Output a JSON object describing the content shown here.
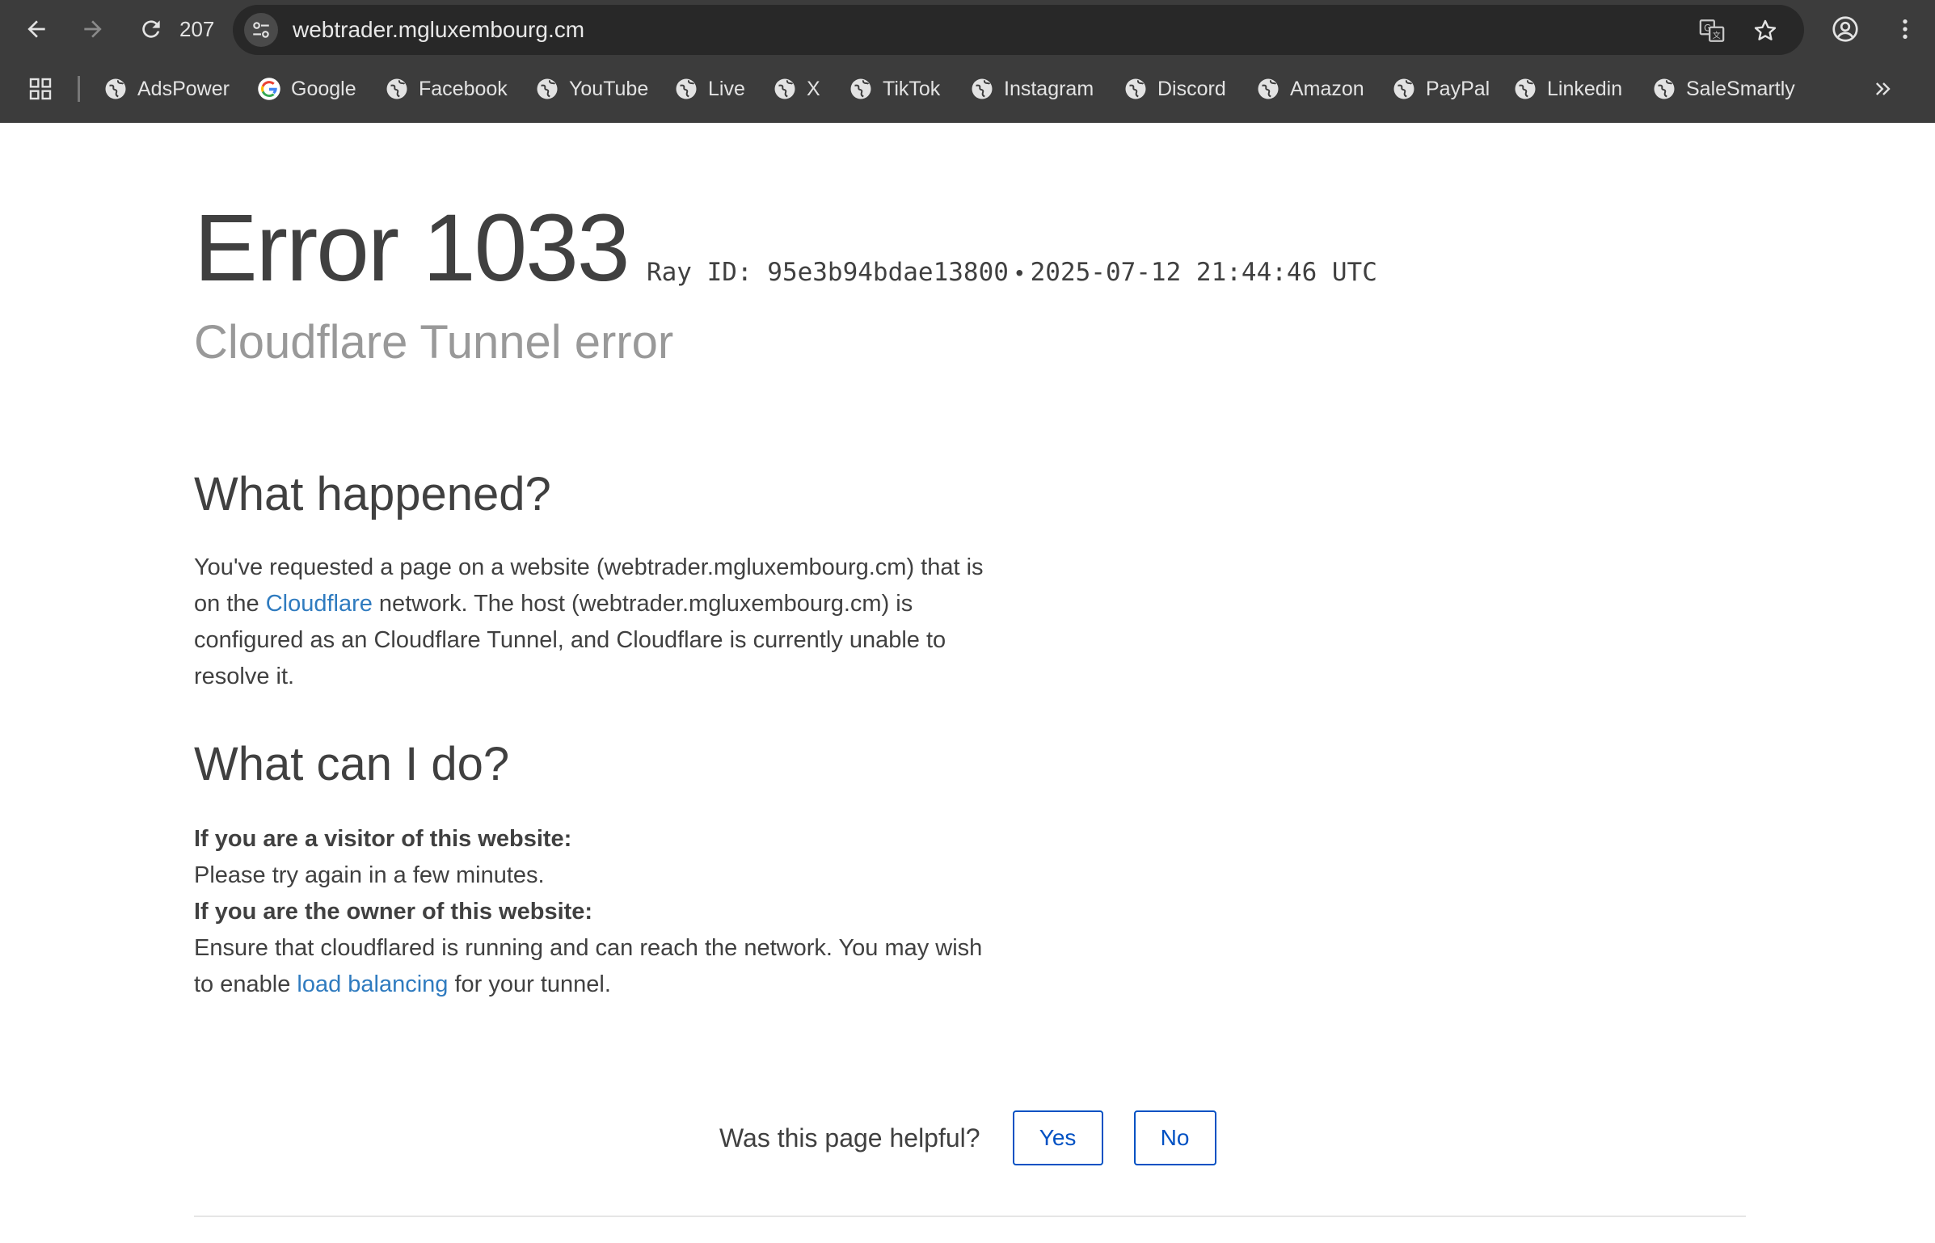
{
  "browser": {
    "tab_count": "207",
    "url": "webtrader.mgluxembourg.cm",
    "bookmarks": [
      {
        "label": "AdsPower",
        "icon": "globe-icon"
      },
      {
        "label": "Google",
        "icon": "google-icon"
      },
      {
        "label": "Facebook",
        "icon": "globe-icon"
      },
      {
        "label": "YouTube",
        "icon": "globe-icon"
      },
      {
        "label": "Live",
        "icon": "globe-icon"
      },
      {
        "label": "X",
        "icon": "globe-icon"
      },
      {
        "label": "TikTok",
        "icon": "globe-icon"
      },
      {
        "label": "Instagram",
        "icon": "globe-icon"
      },
      {
        "label": "Discord",
        "icon": "globe-icon"
      },
      {
        "label": "Amazon",
        "icon": "globe-icon"
      },
      {
        "label": "PayPal",
        "icon": "globe-icon"
      },
      {
        "label": "Linkedin",
        "icon": "globe-icon"
      },
      {
        "label": "SaleSmartly",
        "icon": "globe-icon"
      }
    ]
  },
  "error": {
    "title": "Error 1033",
    "ray_id": "Ray ID: 95e3b94bdae13800",
    "dot": "•",
    "timestamp": "2025-07-12 21:44:46 UTC",
    "subtitle": "Cloudflare Tunnel error"
  },
  "what_happened": {
    "heading": "What happened?",
    "text_1": "You've requested a page on a website (webtrader.mgluxembourg.cm) that is on the ",
    "link": "Cloudflare",
    "text_2": " network. The host (webtrader.mgluxembourg.cm) is configured as an Cloudflare Tunnel, and Cloudflare is currently unable to resolve it."
  },
  "what_can_i_do": {
    "heading": "What can I do?",
    "visitor_label": "If you are a visitor of this website:",
    "visitor_text": "Please try again in a few minutes.",
    "owner_label": "If you are the owner of this website:",
    "owner_text_1": "Ensure that cloudflared is running and can reach the network. You may wish to enable ",
    "owner_link": "load balancing",
    "owner_text_2": " for your tunnel."
  },
  "feedback": {
    "question": "Was this page helpful?",
    "yes": "Yes",
    "no": "No"
  },
  "colors": {
    "chrome_bg": "#3c3c3c",
    "link": "#2f7bbf",
    "button_border": "#0051c3"
  }
}
